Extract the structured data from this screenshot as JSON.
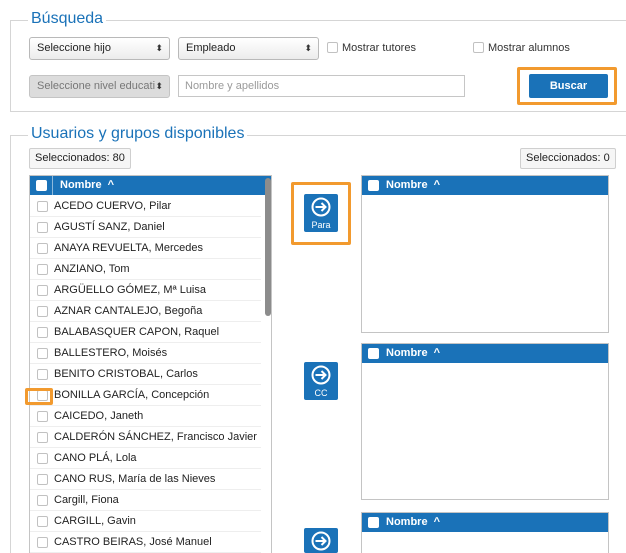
{
  "search": {
    "legend": "Búsqueda",
    "child_select": "Seleccione hijo",
    "role_select": "Empleado",
    "show_tutors": "Mostrar tutores",
    "show_students": "Mostrar alumnos",
    "level_select": "Seleccione nivel educati",
    "name_placeholder": "Nombre y apellidos",
    "search_button": "Buscar"
  },
  "users": {
    "legend": "Usuarios y grupos disponibles",
    "selected_left": "Seleccionados: 80",
    "selected_right": "Seleccionados: 0",
    "column_header": "Nombre",
    "sort_icon": "chevron-up-icon",
    "rows": [
      "ACEDO CUERVO, Pilar",
      "AGUSTÍ SANZ, Daniel",
      "ANAYA REVUELTA, Mercedes",
      "ANZIANO, Tom",
      "ARGÜELLO GÓMEZ, Mª Luisa",
      "AZNAR CANTALEJO, Begoña",
      "BALABASQUER CAPON, Raquel",
      "BALLESTERO, Moisés",
      "BENITO CRISTOBAL, Carlos",
      "BONILLA GARCÍA, Concepción",
      "CAICEDO, Janeth",
      "CALDERÓN SÁNCHEZ, Francisco Javier",
      "CANO PLÁ, Lola",
      "CANO RUS, María de las Nieves",
      "Cargill, Fiona",
      "CARGILL, Gavin",
      "CASTRO BEIRAS, José Manuel"
    ]
  },
  "recipients": {
    "to_label": "Para",
    "cc_label": "CC",
    "to_header": "Nombre",
    "cc_header": "Nombre",
    "third_header": "Nombre"
  },
  "colors": {
    "primary": "#1a72b8",
    "highlight": "#f29a2e"
  }
}
